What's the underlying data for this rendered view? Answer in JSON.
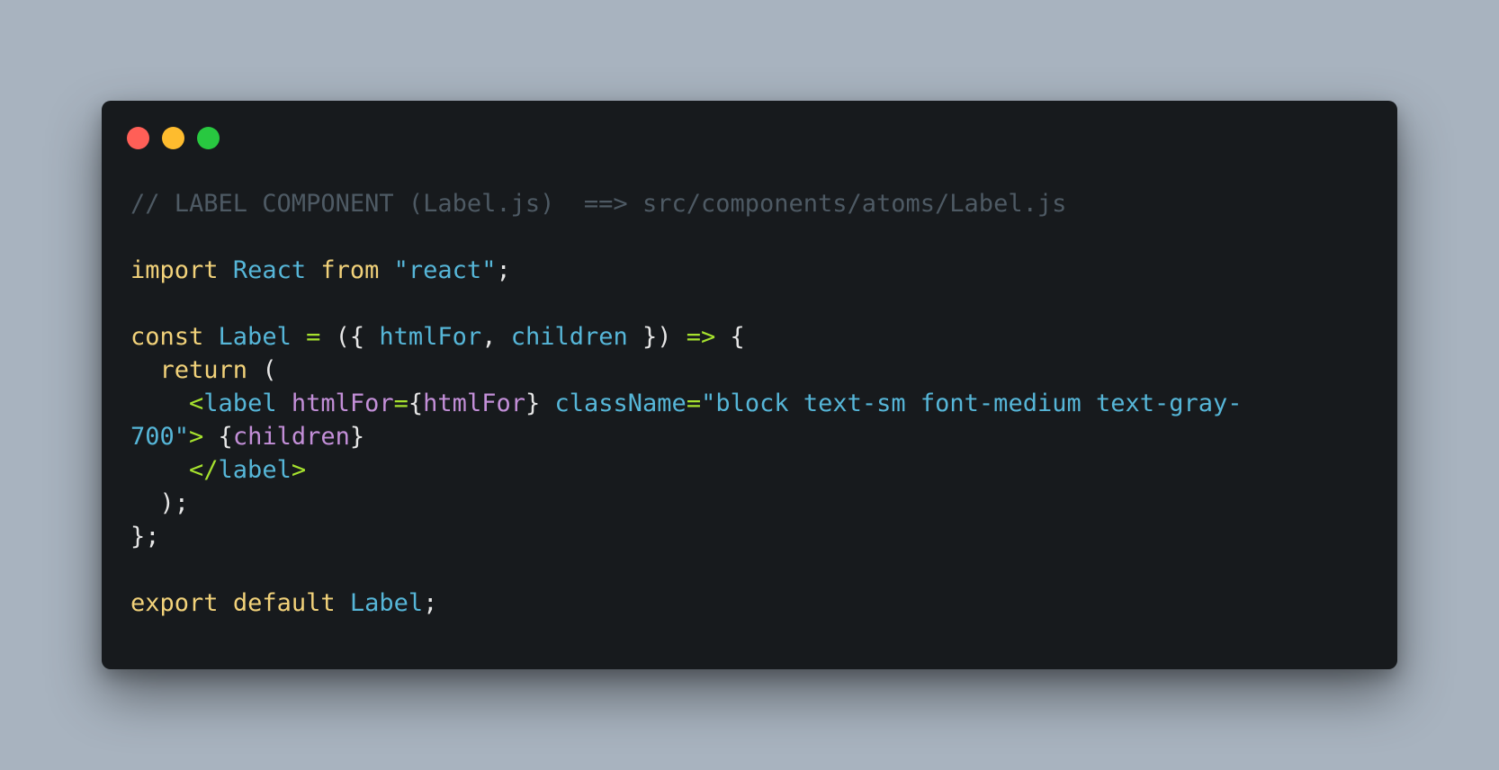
{
  "colors": {
    "background": "#a8b3bf",
    "window": "#171a1d",
    "close": "#ff5f57",
    "minimize": "#febc2e",
    "maximize": "#28c840",
    "comment": "#4e5a64",
    "keyword": "#f2d27a",
    "identifier": "#56b6d8",
    "string": "#56b6d8",
    "operator": "#a6e22e",
    "punctuation": "#e6e6e6",
    "attribute": "#c38fd8"
  },
  "window_controls": [
    {
      "name": "close-dot",
      "color": "#ff5f57"
    },
    {
      "name": "minimize-dot",
      "color": "#febc2e"
    },
    {
      "name": "maximize-dot",
      "color": "#28c840"
    }
  ],
  "code_lines": [
    [
      {
        "t": "// LABEL COMPONENT (Label.js)  ==> src/components/atoms/Label.js",
        "c": "comment"
      }
    ],
    [],
    [
      {
        "t": "import",
        "c": "keyword"
      },
      {
        "t": " ",
        "c": "punctuation"
      },
      {
        "t": "React",
        "c": "identifier"
      },
      {
        "t": " ",
        "c": "punctuation"
      },
      {
        "t": "from",
        "c": "keyword"
      },
      {
        "t": " ",
        "c": "punctuation"
      },
      {
        "t": "\"react\"",
        "c": "string"
      },
      {
        "t": ";",
        "c": "punctuation"
      }
    ],
    [],
    [
      {
        "t": "const",
        "c": "keyword"
      },
      {
        "t": " ",
        "c": "punctuation"
      },
      {
        "t": "Label",
        "c": "identifier"
      },
      {
        "t": " ",
        "c": "punctuation"
      },
      {
        "t": "=",
        "c": "operator"
      },
      {
        "t": " ({ ",
        "c": "punctuation"
      },
      {
        "t": "htmlFor",
        "c": "identifier"
      },
      {
        "t": ", ",
        "c": "punctuation"
      },
      {
        "t": "children",
        "c": "identifier"
      },
      {
        "t": " }) ",
        "c": "punctuation"
      },
      {
        "t": "=>",
        "c": "operator"
      },
      {
        "t": " {",
        "c": "punctuation"
      }
    ],
    [
      {
        "t": "  ",
        "c": "punctuation"
      },
      {
        "t": "return",
        "c": "keyword"
      },
      {
        "t": " (",
        "c": "punctuation"
      }
    ],
    [
      {
        "t": "    ",
        "c": "punctuation"
      },
      {
        "t": "<",
        "c": "operator"
      },
      {
        "t": "label",
        "c": "identifier"
      },
      {
        "t": " ",
        "c": "punctuation"
      },
      {
        "t": "htmlFor",
        "c": "attribute"
      },
      {
        "t": "=",
        "c": "operator"
      },
      {
        "t": "{",
        "c": "punctuation"
      },
      {
        "t": "htmlFor",
        "c": "attribute"
      },
      {
        "t": "}",
        "c": "punctuation"
      },
      {
        "t": " ",
        "c": "punctuation"
      },
      {
        "t": "className",
        "c": "identifier"
      },
      {
        "t": "=",
        "c": "operator"
      },
      {
        "t": "\"block text-sm font-medium text-gray-",
        "c": "string"
      }
    ],
    [
      {
        "t": "700\"",
        "c": "string"
      },
      {
        "t": ">",
        "c": "operator"
      },
      {
        "t": " {",
        "c": "punctuation"
      },
      {
        "t": "children",
        "c": "attribute"
      },
      {
        "t": "}",
        "c": "punctuation"
      }
    ],
    [
      {
        "t": "    ",
        "c": "punctuation"
      },
      {
        "t": "</",
        "c": "operator"
      },
      {
        "t": "label",
        "c": "identifier"
      },
      {
        "t": ">",
        "c": "operator"
      }
    ],
    [
      {
        "t": "  );",
        "c": "punctuation"
      }
    ],
    [
      {
        "t": "};",
        "c": "punctuation"
      }
    ],
    [],
    [
      {
        "t": "export",
        "c": "keyword"
      },
      {
        "t": " ",
        "c": "punctuation"
      },
      {
        "t": "default",
        "c": "keyword"
      },
      {
        "t": " ",
        "c": "punctuation"
      },
      {
        "t": "Label",
        "c": "identifier"
      },
      {
        "t": ";",
        "c": "punctuation"
      }
    ]
  ]
}
